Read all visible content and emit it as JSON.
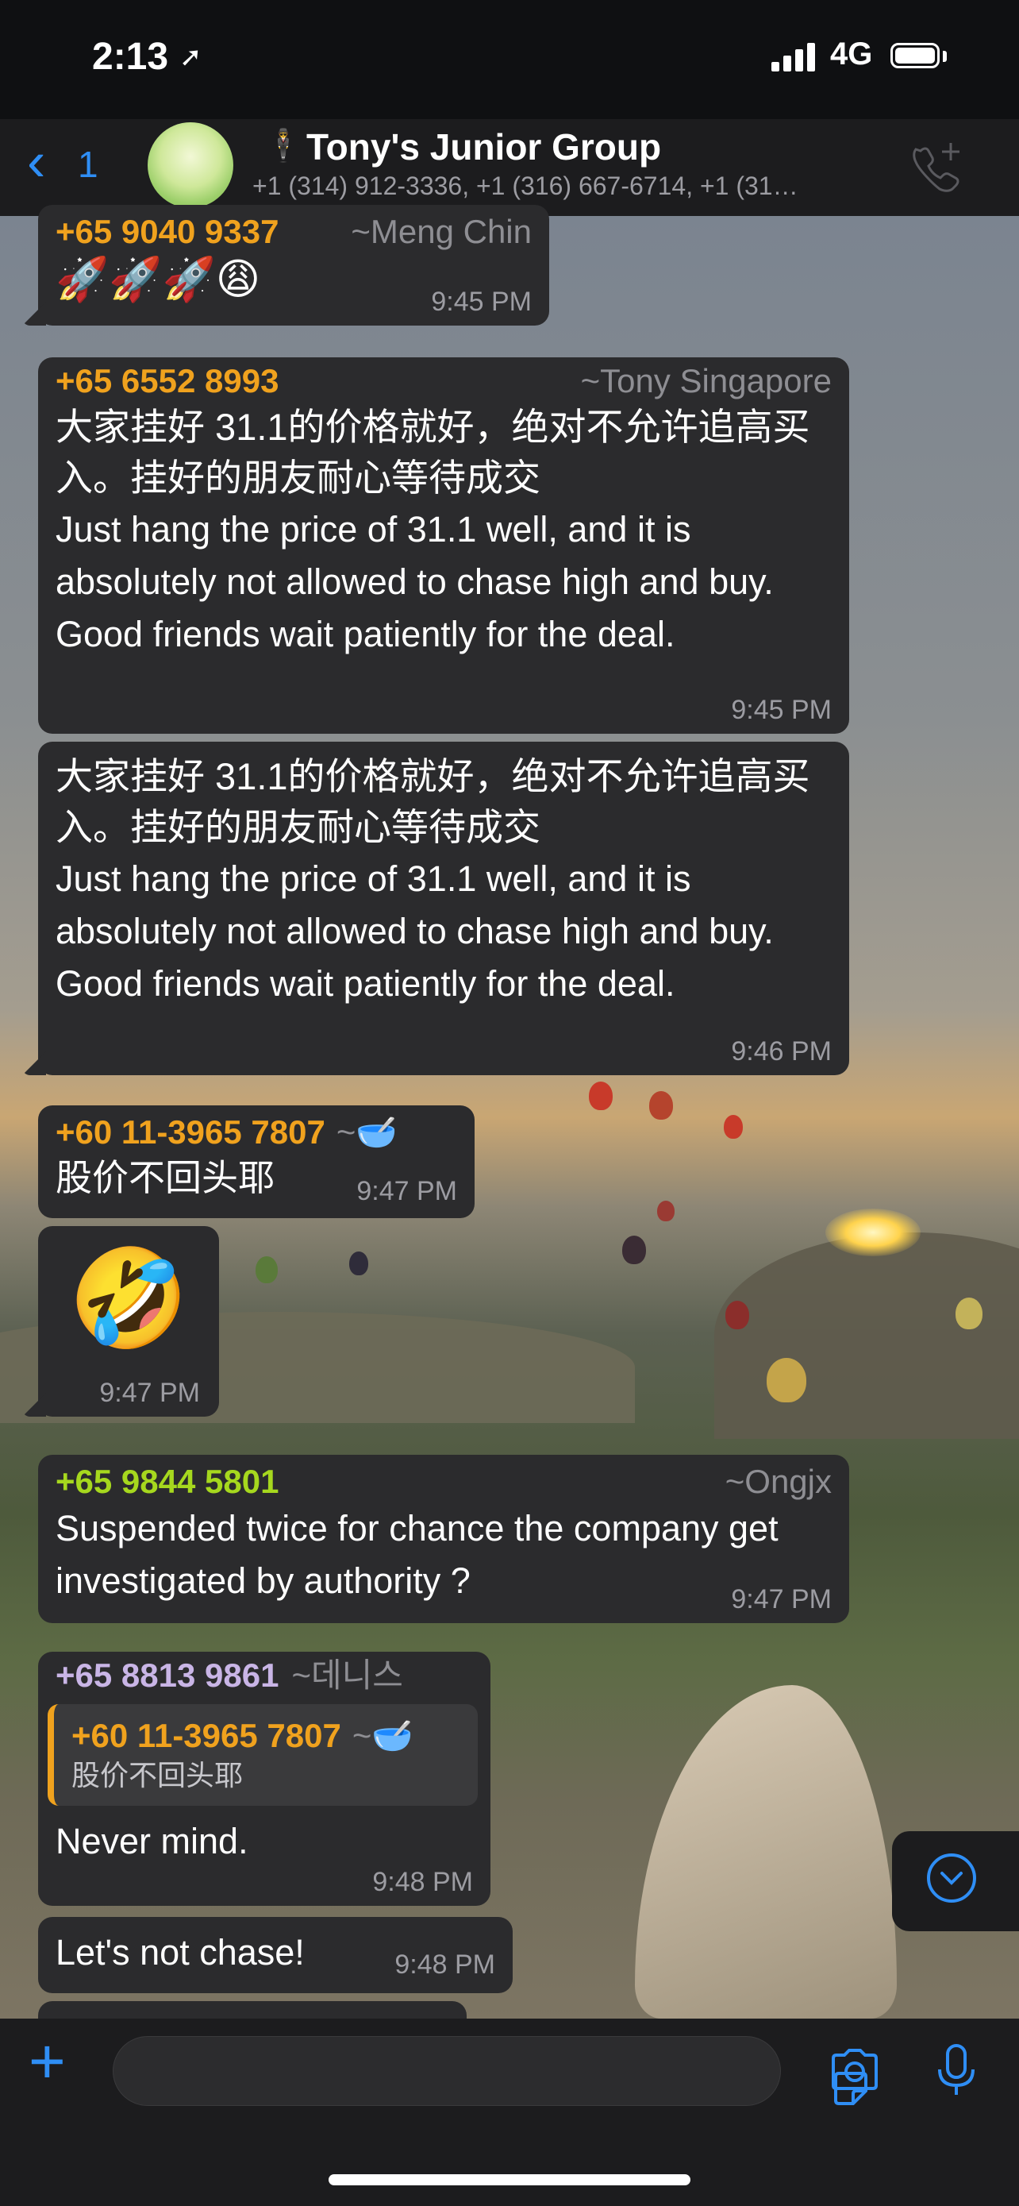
{
  "status_bar": {
    "time": "2:13",
    "network": "4G"
  },
  "header": {
    "back_count": "1",
    "group_name": "Tony's Junior Group",
    "members": "+1 (314) 912-3336, +1 (316) 667-6714, +1 (31…"
  },
  "colors": {
    "accent": "#2f8ef5",
    "bubble": "#2b2b2d",
    "sender_orange": "#f0a21e",
    "sender_green": "#a6d81e",
    "sender_lavender": "#c9b5e6"
  },
  "messages": [
    {
      "phone": "+65 9040 9337",
      "alias": "~Meng Chin",
      "text": "🚀🚀🚀😩",
      "time": "9:45 PM"
    },
    {
      "phone": "+65 6552 8993",
      "alias": "~Tony Singapore",
      "cn": "大家挂好 31.1的价格就好，绝对不允许追高买入。挂好的朋友耐心等待成交",
      "text": "Just hang the price of 31.1 well, and it is absolutely not allowed to chase high and buy. Good friends wait patiently for the deal.",
      "time": "9:45 PM"
    },
    {
      "cn": "大家挂好 31.1的价格就好，绝对不允许追高买入。挂好的朋友耐心等待成交",
      "text": "Just hang the price of 31.1 well, and it is absolutely not allowed to chase high and buy. Good friends wait patiently for the deal.",
      "time": "9:46 PM"
    },
    {
      "phone": "+60 11-3965 7807",
      "alias": "~🥣",
      "text": "股价不回头耶",
      "time": "9:47 PM"
    },
    {
      "emoji": "🤣",
      "time": "9:47 PM"
    },
    {
      "phone": "+65 9844 5801",
      "alias": "~Ongjx",
      "text": "Suspended twice for chance the company get investigated by authority ?",
      "time": "9:47 PM"
    },
    {
      "phone": "+65 8813 9861",
      "alias": "~데니스",
      "reply_phone": "+60 11-3965 7807",
      "reply_alias": "~🥣",
      "reply_text": "股价不回头耶",
      "text": "Never mind.",
      "time": "9:48 PM"
    },
    {
      "text": "Let's not chase!",
      "time": "9:48 PM"
    }
  ]
}
